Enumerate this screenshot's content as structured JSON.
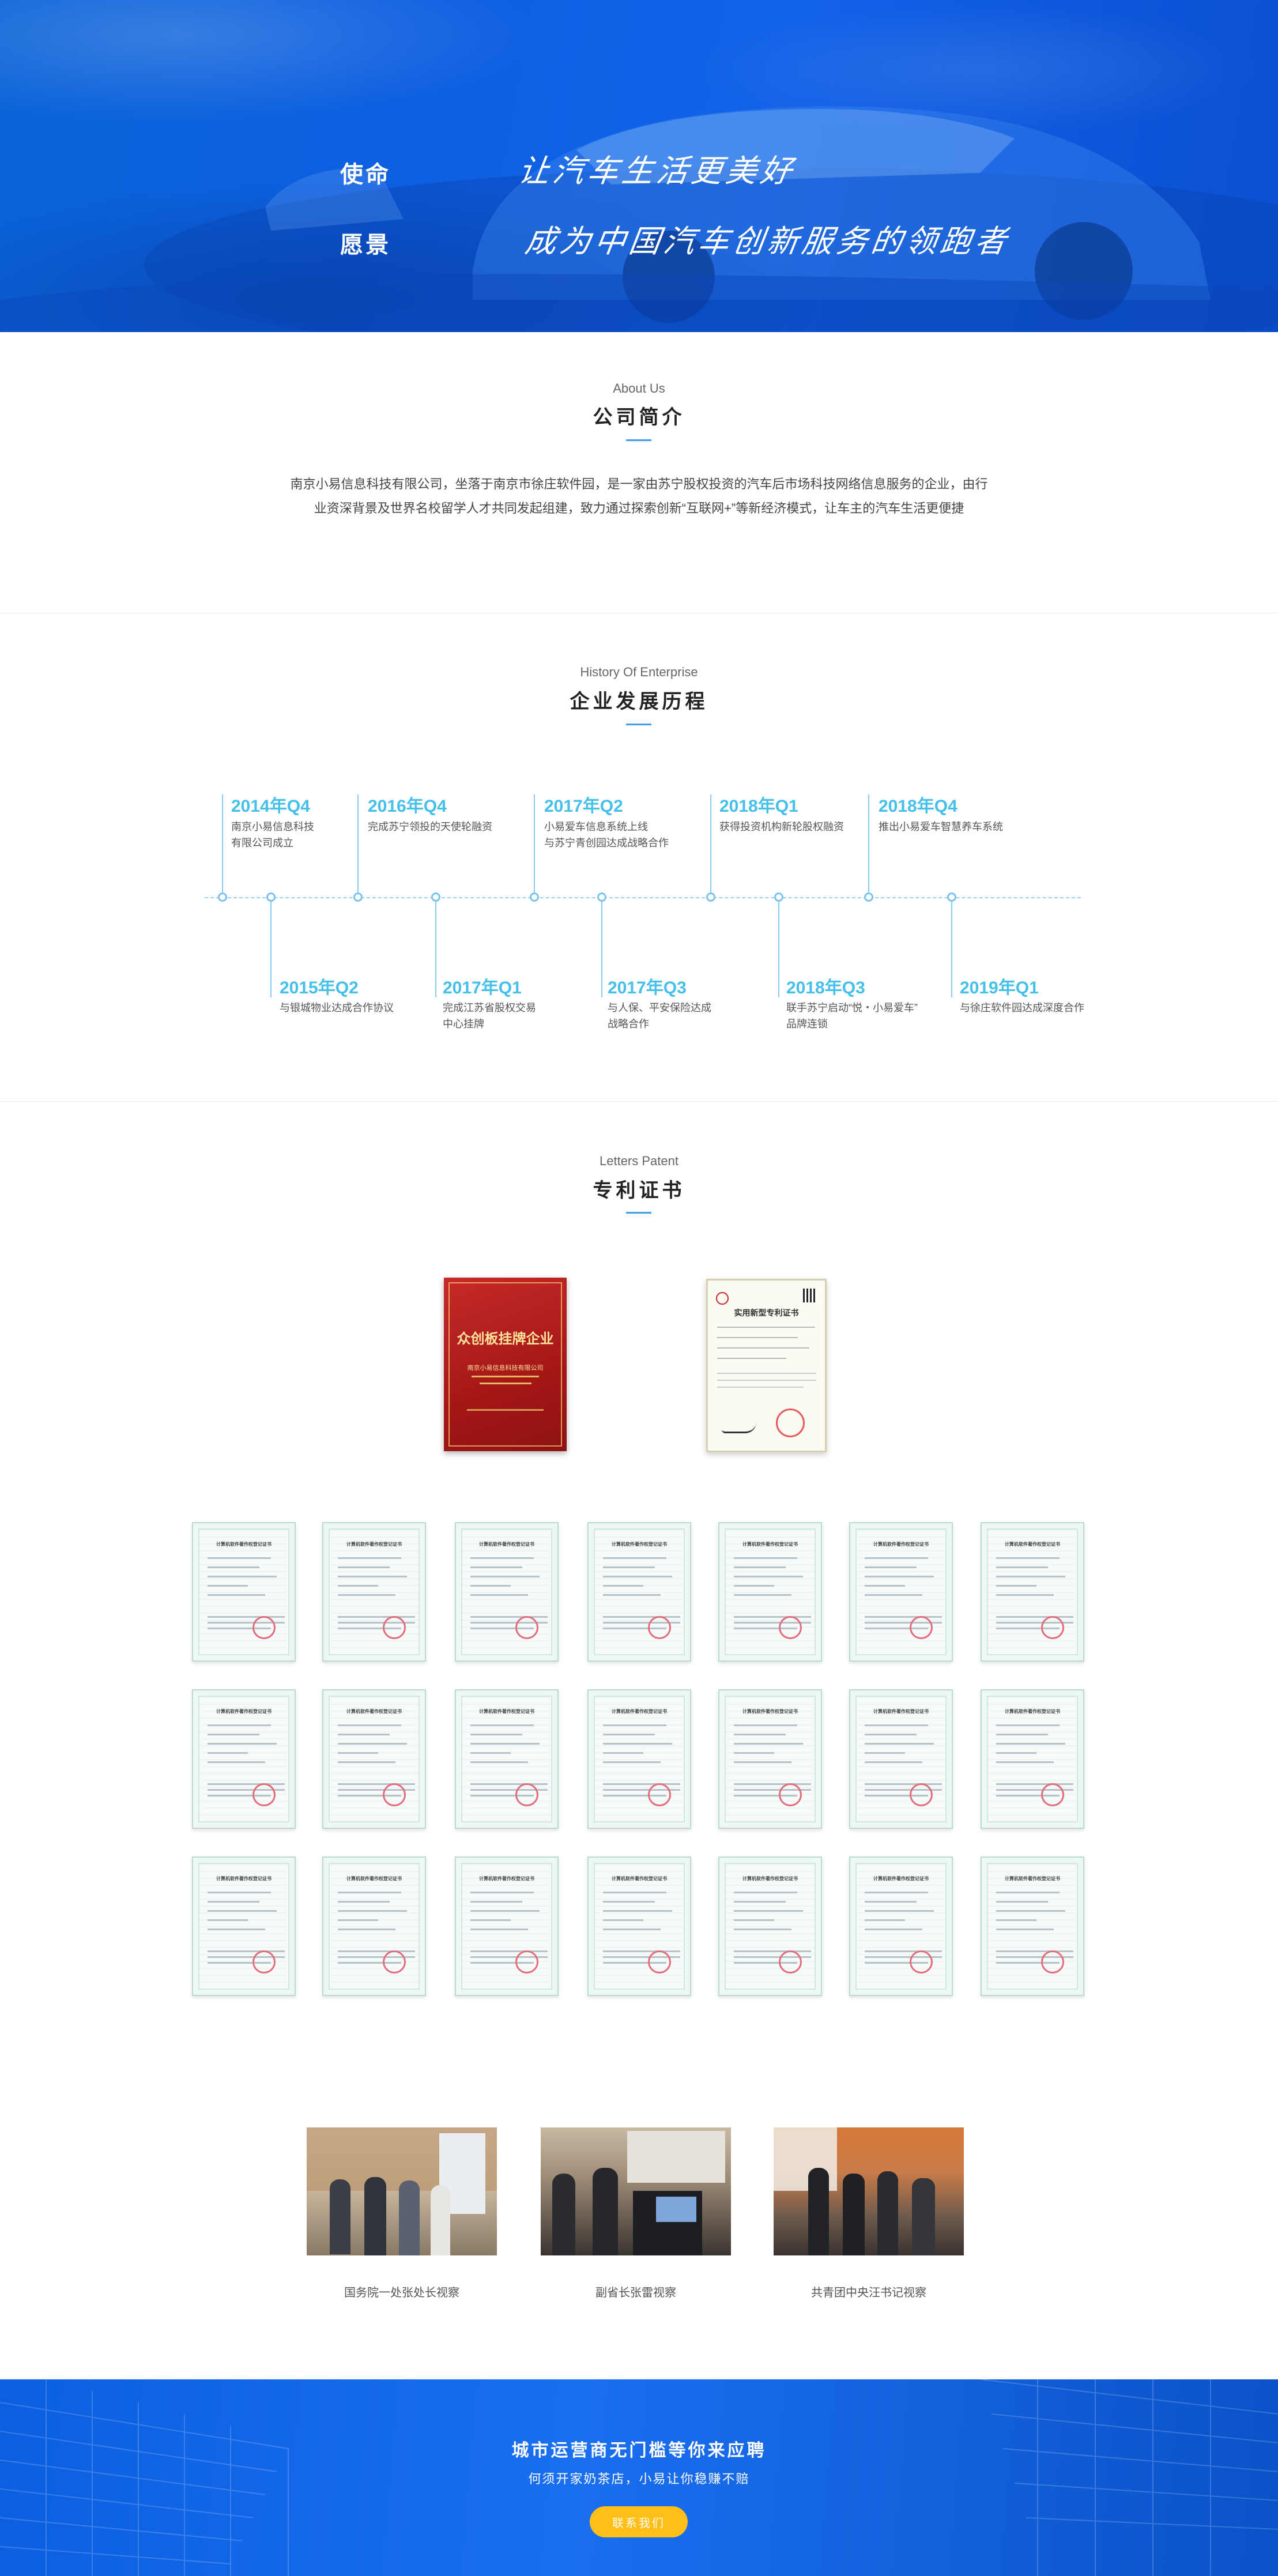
{
  "hero": {
    "mission_label": "使命",
    "mission_text": "让汽车生活更美好",
    "vision_label": "愿景",
    "vision_text": "成为中国汽车创新服务的领跑者"
  },
  "about": {
    "en": "About Us",
    "cn": "公司简介",
    "line1": "南京小易信息科技有限公司，坐落于南京市徐庄软件园，是一家由苏宁股权投资的汽车后市场科技网络信息服务的企业，由行",
    "line2": "业资深背景及世界名校留学人才共同发起组建，致力通过探索创新“互联网+”等新经济模式，让车主的汽车生活更便捷"
  },
  "history": {
    "en": "History Of Enterprise",
    "cn": "企业发展历程",
    "top": [
      {
        "year": "2014年Q4",
        "l1": "南京小易信息科技",
        "l2": "有限公司成立"
      },
      {
        "year": "2016年Q4",
        "l1": "完成苏宁领投的天使轮融资",
        "l2": ""
      },
      {
        "year": "2017年Q2",
        "l1": "小易爱车信息系统上线",
        "l2": "与苏宁青创园达成战略合作"
      },
      {
        "year": "2018年Q1",
        "l1": "获得投资机构新轮股权融资",
        "l2": ""
      },
      {
        "year": "2018年Q4",
        "l1": "推出小易爱车智慧养车系统",
        "l2": ""
      }
    ],
    "bottom": [
      {
        "year": "2015年Q2",
        "l1": "与银城物业达成合作协议",
        "l2": ""
      },
      {
        "year": "2017年Q1",
        "l1": "完成江苏省股权交易",
        "l2": "中心挂牌"
      },
      {
        "year": "2017年Q3",
        "l1": "与人保、平安保险达成",
        "l2": "战略合作"
      },
      {
        "year": "2018年Q3",
        "l1": "联手苏宁启动“悦・小易爱车”",
        "l2": "品牌连锁"
      },
      {
        "year": "2019年Q1",
        "l1": "与徐庄软件园达成深度合作",
        "l2": ""
      }
    ]
  },
  "patent": {
    "en": "Letters Patent",
    "cn": "专利证书",
    "award_plaque": "众创板挂牌企业",
    "award_sub1": "南京小易信息科技有限公司",
    "utility_cert": "实用新型专利证书",
    "cert_title": "计算机软件著作权登记证书",
    "cert_count": 21
  },
  "visits": [
    {
      "caption": "国务院一处张处长视察"
    },
    {
      "caption": "副省长张雷视察"
    },
    {
      "caption": "共青团中央汪书记视察"
    }
  ],
  "cta": {
    "heading": "城市运营商无门槛等你来应聘",
    "sub": "何须开家奶茶店，小易让你稳赚不赔",
    "button": "联系我们"
  },
  "colors": {
    "hero_blue": "#0d5fe0",
    "timeline_accent": "#45c0ea",
    "section_bar": "#3fa2e9",
    "button_yellow": "#ffbf16"
  }
}
